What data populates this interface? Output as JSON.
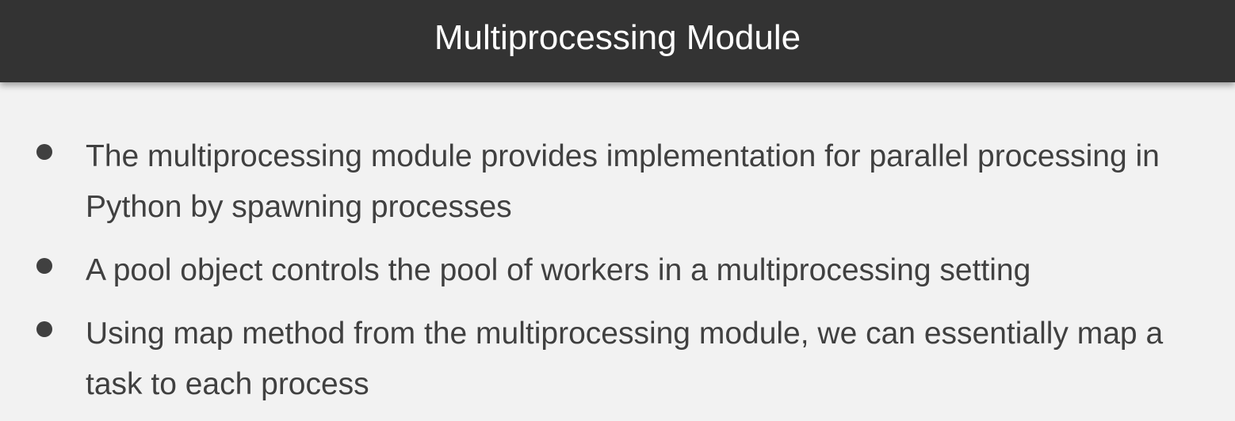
{
  "slide": {
    "title": "Multiprocessing Module",
    "bullets": [
      "The multiprocessing module provides implementation for parallel processing in Python by spawning processes",
      "A pool object controls the pool of workers in a multiprocessing setting",
      "Using map method from the multiprocessing module, we can essentially map a task to each process"
    ]
  },
  "colors": {
    "header_background": "#333333",
    "title_text": "#ffffff",
    "body_background": "#f2f2f2",
    "body_text": "#404040"
  }
}
